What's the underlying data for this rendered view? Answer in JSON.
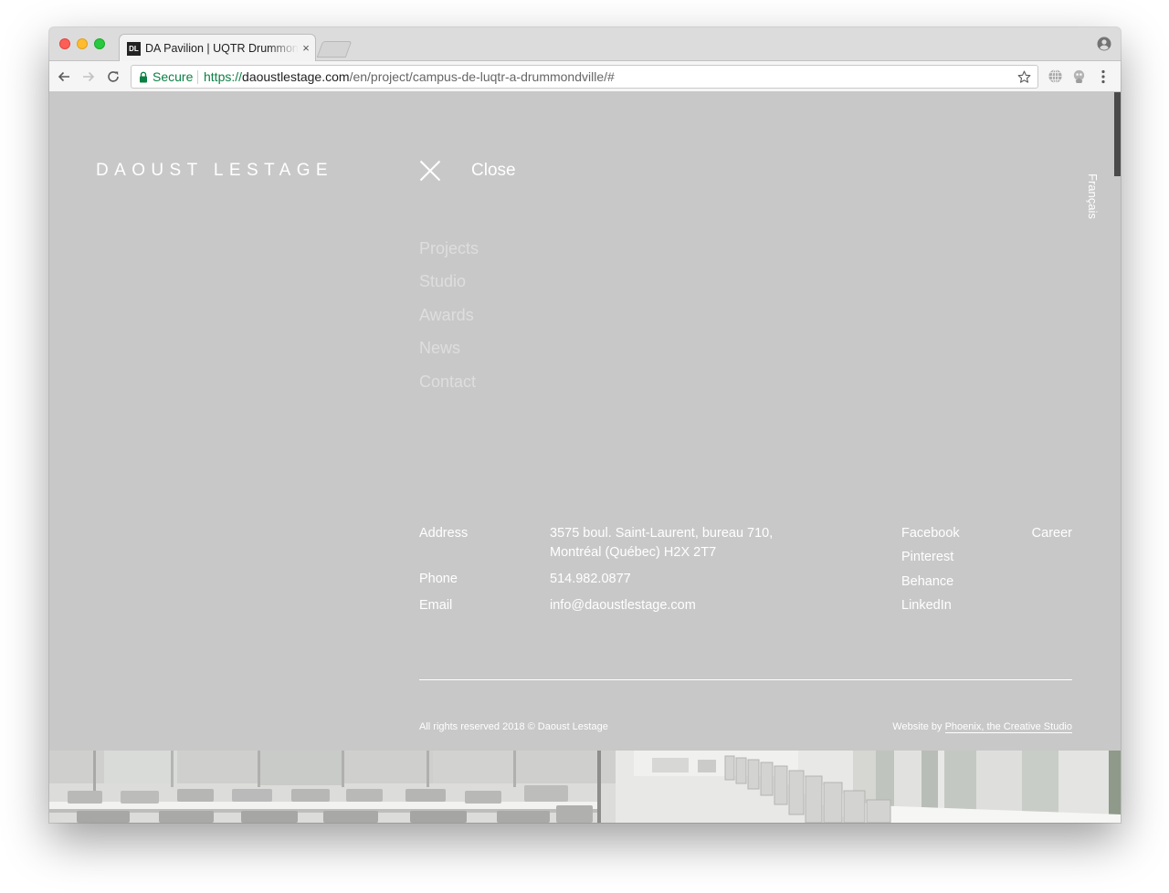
{
  "browser": {
    "tab": {
      "favicon": "DL",
      "title": "DA Pavilion | UQTR Drummondville",
      "close_glyph": "×"
    },
    "address_bar": {
      "secure_label": "Secure",
      "url_scheme": "https://",
      "url_host": "daoustlestage.com",
      "url_path": "/en/project/campus-de-luqtr-a-drummondville/#"
    },
    "icons": [
      "back-arrow-icon",
      "forward-arrow-icon",
      "reload-icon",
      "lock-icon",
      "star-icon",
      "globe-icon",
      "extension-icon",
      "more-vert-icon",
      "profile-icon"
    ]
  },
  "site": {
    "logo": "DAOUST LESTAGE",
    "close_label": "Close",
    "language_toggle": "Français",
    "menu": [
      "Projects",
      "Studio",
      "Awards",
      "News",
      "Contact"
    ],
    "contact": {
      "address_label": "Address",
      "address_line1": "3575 boul. Saint-Laurent, bureau 710,",
      "address_line2": "Montréal (Québec) H2X 2T7",
      "phone_label": "Phone",
      "phone": "514.982.0877",
      "email_label": "Email",
      "email": "info@daoustlestage.com"
    },
    "social": [
      "Facebook",
      "Pinterest",
      "Behance",
      "LinkedIn"
    ],
    "career": "Career",
    "footer": {
      "copyright": "All rights reserved 2018 © Daoust Lestage",
      "credit_prefix": "Website by",
      "credit_link": "Phoenix, the Creative Studio"
    }
  },
  "colors": {
    "overlay_bg": "#c8c8c8",
    "text": "#ffffff",
    "menu_text": "#dedede",
    "secure_green": "#0b8043"
  }
}
